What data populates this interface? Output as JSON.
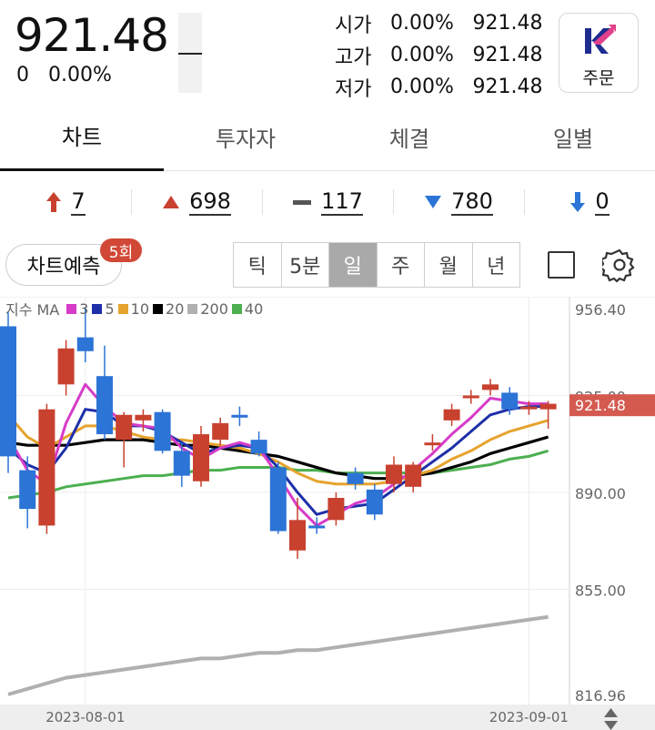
{
  "quote": {
    "price": "921.48",
    "change": "0",
    "change_pct": "0.00%",
    "open_label": "시가",
    "open_pct": "0.00%",
    "open_value": "921.48",
    "high_label": "고가",
    "high_pct": "0.00%",
    "high_value": "921.48",
    "low_label": "저가",
    "low_pct": "0.00%",
    "low_value": "921.48"
  },
  "order_button": {
    "label": "주문",
    "icon": "k-logo-icon"
  },
  "tabs": [
    {
      "label": "차트",
      "active": true
    },
    {
      "label": "투자자",
      "active": false
    },
    {
      "label": "체결",
      "active": false
    },
    {
      "label": "일별",
      "active": false
    }
  ],
  "stats": [
    {
      "icon": "upper-limit-arrow-icon",
      "value": "7",
      "color": "#c8412f"
    },
    {
      "icon": "up-triangle-icon",
      "value": "698",
      "color": "#c8412f"
    },
    {
      "icon": "flat-dash-icon",
      "value": "117",
      "color": "#555555"
    },
    {
      "icon": "down-triangle-icon",
      "value": "780",
      "color": "#2c74d6"
    },
    {
      "icon": "lower-limit-arrow-icon",
      "value": "0",
      "color": "#2c74d6"
    }
  ],
  "controls": {
    "predict_label": "차트예측",
    "predict_badge": "5회",
    "periods": [
      "틱",
      "5분",
      "일",
      "주",
      "월",
      "년"
    ],
    "selected_period": "일"
  },
  "chart_data": {
    "type": "candlestick",
    "legend_title": "지수 MA",
    "ma_series": [
      {
        "name": "3",
        "color": "#d63cc8"
      },
      {
        "name": "5",
        "color": "#1e2fa8"
      },
      {
        "name": "10",
        "color": "#e6a32e"
      },
      {
        "name": "20",
        "color": "#000000"
      },
      {
        "name": "200",
        "color": "#b0b0b0"
      },
      {
        "name": "40",
        "color": "#4caf50"
      }
    ],
    "up_color": "#c8412f",
    "down_color": "#2c74d6",
    "y_ticks": [
      "956.40",
      "925.00",
      "890.00",
      "855.00",
      "816.96"
    ],
    "y_range": [
      816.96,
      956.4
    ],
    "x_ticks": [
      "2023-08-01",
      "2023-09-01"
    ],
    "current_value": "921.48",
    "candles": [
      {
        "o": 950,
        "c": 903,
        "h": 955,
        "l": 897
      },
      {
        "o": 898,
        "c": 884,
        "h": 903,
        "l": 877
      },
      {
        "o": 878,
        "c": 920,
        "h": 922,
        "l": 875
      },
      {
        "o": 929,
        "c": 942,
        "h": 945,
        "l": 925
      },
      {
        "o": 946,
        "c": 941,
        "h": 957,
        "l": 937
      },
      {
        "o": 932,
        "c": 911,
        "h": 943,
        "l": 909
      },
      {
        "o": 909,
        "c": 918,
        "h": 919,
        "l": 899
      },
      {
        "o": 916,
        "c": 918,
        "h": 920,
        "l": 912
      },
      {
        "o": 919,
        "c": 905,
        "h": 920,
        "l": 904
      },
      {
        "o": 905,
        "c": 896,
        "h": 908,
        "l": 892
      },
      {
        "o": 894,
        "c": 911,
        "h": 914,
        "l": 892
      },
      {
        "o": 909,
        "c": 915,
        "h": 917,
        "l": 907
      },
      {
        "o": 918,
        "c": 917,
        "h": 921,
        "l": 914
      },
      {
        "o": 909,
        "c": 904,
        "h": 912,
        "l": 903
      },
      {
        "o": 899,
        "c": 876,
        "h": 901,
        "l": 875
      },
      {
        "o": 869,
        "c": 880,
        "h": 888,
        "l": 866
      },
      {
        "o": 878,
        "c": 877,
        "h": 881,
        "l": 875
      },
      {
        "o": 880,
        "c": 888,
        "h": 890,
        "l": 878
      },
      {
        "o": 897,
        "c": 893,
        "h": 899,
        "l": 891
      },
      {
        "o": 891,
        "c": 882,
        "h": 893,
        "l": 880
      },
      {
        "o": 893,
        "c": 900,
        "h": 903,
        "l": 890
      },
      {
        "o": 892,
        "c": 900,
        "h": 901,
        "l": 890
      },
      {
        "o": 907,
        "c": 908,
        "h": 911,
        "l": 905
      },
      {
        "o": 916,
        "c": 920,
        "h": 922,
        "l": 914
      },
      {
        "o": 924,
        "c": 925,
        "h": 927,
        "l": 922
      },
      {
        "o": 927,
        "c": 929,
        "h": 931,
        "l": 925
      },
      {
        "o": 926,
        "c": 920,
        "h": 928,
        "l": 918
      },
      {
        "o": 920,
        "c": 921,
        "h": 923,
        "l": 918
      },
      {
        "o": 920,
        "c": 922,
        "h": 923,
        "l": 913
      }
    ],
    "ma": {
      "3": [
        910,
        898,
        893,
        915,
        929,
        921,
        915,
        914,
        913,
        906,
        902,
        906,
        908,
        906,
        896,
        885,
        878,
        882,
        886,
        888,
        893,
        898,
        904,
        911,
        917,
        924,
        923,
        922,
        922
      ],
      "5": [
        906,
        900,
        897,
        906,
        920,
        919,
        914,
        914,
        912,
        908,
        904,
        906,
        907,
        906,
        899,
        890,
        882,
        884,
        885,
        886,
        891,
        896,
        901,
        906,
        912,
        918,
        920,
        921,
        921
      ],
      "10": [
        918,
        910,
        906,
        910,
        914,
        914,
        912,
        910,
        909,
        909,
        908,
        907,
        906,
        904,
        901,
        897,
        894,
        893,
        893,
        893,
        894,
        896,
        898,
        902,
        905,
        909,
        912,
        914,
        916
      ],
      "20": [
        908,
        907,
        907,
        907,
        908,
        909,
        909,
        909,
        908,
        907,
        907,
        906,
        905,
        904,
        903,
        901,
        899,
        897,
        896,
        895,
        895,
        896,
        897,
        899,
        901,
        904,
        906,
        908,
        910
      ],
      "40": [
        888,
        889,
        890,
        892,
        893,
        894,
        895,
        896,
        896,
        897,
        898,
        898,
        899,
        899,
        899,
        898,
        898,
        897,
        897,
        897,
        897,
        897,
        897,
        898,
        899,
        900,
        902,
        903,
        905
      ],
      "200": [
        817,
        819,
        821,
        823,
        824,
        825,
        826,
        827,
        828,
        829,
        830,
        830,
        831,
        832,
        832,
        833,
        833,
        834,
        835,
        836,
        837,
        838,
        839,
        840,
        841,
        842,
        843,
        844,
        845
      ]
    }
  }
}
